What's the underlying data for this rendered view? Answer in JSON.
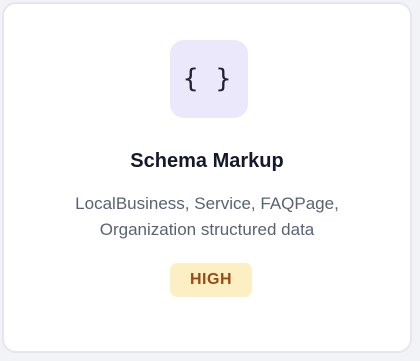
{
  "card": {
    "icon": {
      "name": "code-braces-icon",
      "glyph": "{ }",
      "background": "#ebe8fc"
    },
    "title": "Schema Markup",
    "description_line1": "LocalBusiness, Service, FAQPage,",
    "description_line2": "Organization structured data",
    "badge": {
      "label": "HIGH",
      "background": "#fcefc4",
      "color": "#9c4a10"
    }
  }
}
